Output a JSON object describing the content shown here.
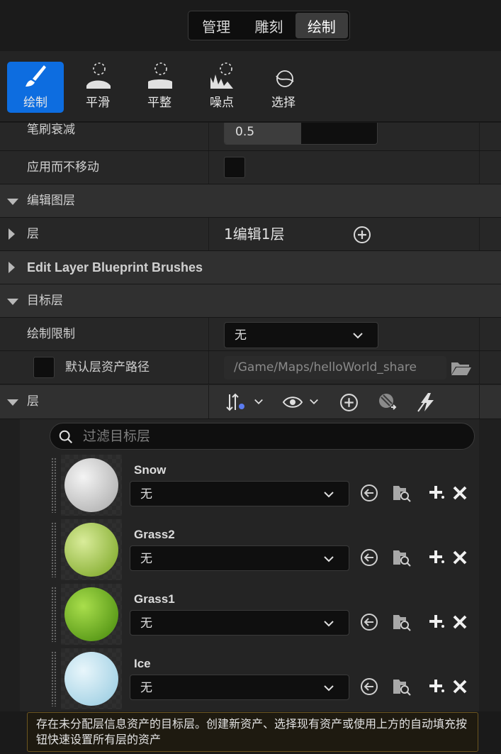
{
  "mode_tabs": [
    {
      "label": "管理",
      "active": false
    },
    {
      "label": "雕刻",
      "active": false
    },
    {
      "label": "绘制",
      "active": true
    }
  ],
  "tools": [
    {
      "label": "绘制",
      "icon": "brush-icon",
      "active": true
    },
    {
      "label": "平滑",
      "icon": "smooth-icon",
      "active": false
    },
    {
      "label": "平整",
      "icon": "flatten-icon",
      "active": false
    },
    {
      "label": "噪点",
      "icon": "noise-icon",
      "active": false
    },
    {
      "label": "选择",
      "icon": "select-icon",
      "active": false
    }
  ],
  "properties": {
    "brush_falloff": {
      "label": "笔刷衰减",
      "value": "0.5",
      "fraction": 0.5
    },
    "apply_without_moving": {
      "label": "应用而不移动",
      "checked": false
    }
  },
  "edit_layers": {
    "title": "编辑图层",
    "layers_label": "层",
    "layers_value": "1编辑1层"
  },
  "blueprint_brushes": {
    "title": "Edit Layer Blueprint Brushes"
  },
  "target_layers": {
    "title": "目标层",
    "paint_limit_label": "绘制限制",
    "paint_limit_value": "无",
    "default_path_label": "默认层资产路径",
    "default_path_value": "/Game/Maps/helloWorld_share",
    "layers_label": "层",
    "filter_placeholder": "过滤目标层",
    "items": [
      {
        "name": "Snow",
        "asset": "无",
        "color_light": "#f4f4f4",
        "color_dark": "#b9b9b9"
      },
      {
        "name": "Grass2",
        "asset": "无",
        "color_light": "#d9ec9a",
        "color_dark": "#8eb43c"
      },
      {
        "name": "Grass1",
        "asset": "无",
        "color_light": "#a9de4c",
        "color_dark": "#5c9c1a"
      },
      {
        "name": "Ice",
        "asset": "无",
        "color_light": "#e8f6fb",
        "color_dark": "#a8d4e6"
      }
    ]
  },
  "tooltip": {
    "text": "存在未分配层信息资产的目标层。创建新资产、选择现有资产或使用上方的自动填充按钮快速设置所有层的资产"
  },
  "colors": {
    "accent": "#0d6de0",
    "panel_bg": "#242424",
    "tooltip_border": "#6b5520"
  }
}
